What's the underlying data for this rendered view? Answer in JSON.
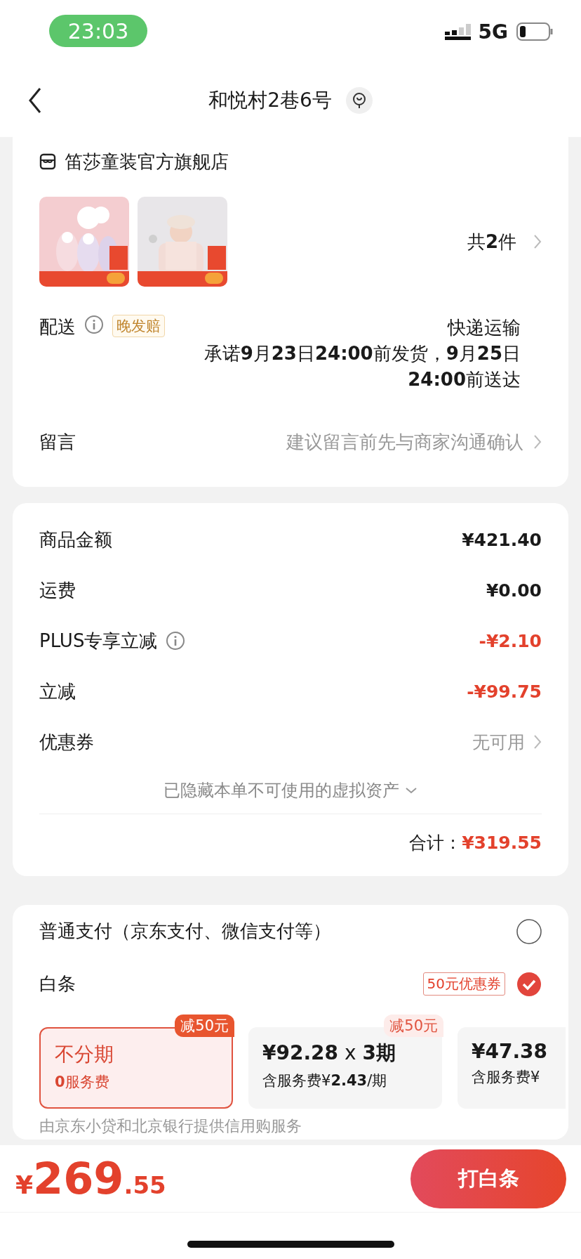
{
  "status_bar": {
    "time": "23:03",
    "network": "5G"
  },
  "nav": {
    "title": "和悦村2巷6号"
  },
  "store": {
    "name": "笛莎童装官方旗舰店",
    "count": "共**2**件"
  },
  "delivery": {
    "label": "配送",
    "badge": "晚发赔",
    "method": "快递运输",
    "promise": "承诺**9**月**23**日**24:00**前发货，**9**月**25**日**24:00**前送达"
  },
  "message": {
    "label": "留言",
    "hint": "建议留言前先与商家沟通确认"
  },
  "price_rows": [
    {
      "label": "商品金额",
      "value": "¥421.40",
      "kind": "normal",
      "info": false
    },
    {
      "label": "运费",
      "value": "¥0.00",
      "kind": "normal",
      "info": false
    },
    {
      "label": "PLUS专享立减",
      "value": "-¥2.10",
      "kind": "discount",
      "info": true
    },
    {
      "label": "立减",
      "value": "-¥99.75",
      "kind": "discount",
      "info": false
    },
    {
      "label": "优惠券",
      "value": "无可用",
      "kind": "link",
      "info": false
    }
  ],
  "hidden_assets": "已隐藏本单不可使用的虚拟资产",
  "total": {
    "label": "合计：",
    "value": "¥319.55"
  },
  "payment": {
    "options": [
      {
        "label": "普通支付（京东支付、微信支付等）",
        "selected": false
      },
      {
        "label": "白条",
        "tag": "50元优惠券",
        "selected": true
      }
    ],
    "plans": [
      {
        "title": "不分期",
        "fee": "**0**服务费",
        "badge": "减50元",
        "selected": true
      },
      {
        "title": "**¥92.28** x **3期**",
        "fee": "含服务费¥**2.43**/期",
        "badge": "减50元",
        "selected": false
      },
      {
        "title": "**¥47.38**",
        "fee": "含服务费¥",
        "selected": false
      }
    ],
    "note": "由京东小贷和北京银行提供信用购服务"
  },
  "bottom": {
    "currency": "¥",
    "amount": "269",
    "decimals": ".55",
    "button": "打白条"
  }
}
